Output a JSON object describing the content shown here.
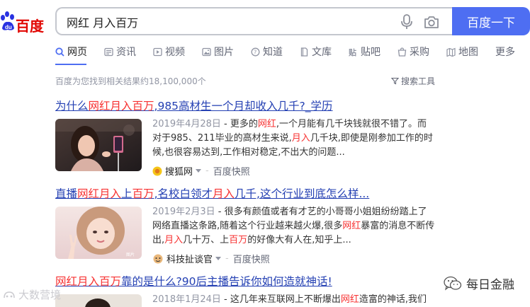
{
  "logo": {
    "text": "百度"
  },
  "search": {
    "query": "网红 月入百万",
    "button_label": "百度一下"
  },
  "tabs": [
    {
      "label": "网页",
      "icon": "search-icon",
      "active": true
    },
    {
      "label": "资讯",
      "icon": "news-icon"
    },
    {
      "label": "视频",
      "icon": "video-icon"
    },
    {
      "label": "图片",
      "icon": "image-icon"
    },
    {
      "label": "知道",
      "icon": "question-icon"
    },
    {
      "label": "文库",
      "icon": "document-icon"
    },
    {
      "label": "贴吧",
      "icon": "tieba-icon"
    },
    {
      "label": "采购",
      "icon": "shop-icon"
    },
    {
      "label": "地图",
      "icon": "map-icon"
    },
    {
      "label": "更多"
    }
  ],
  "meta": {
    "result_count": "百度为您找到相关结果约18,100,000个",
    "tools_label": "搜索工具"
  },
  "results": [
    {
      "title": [
        {
          "t": "为什么"
        },
        {
          "t": "网红月入百万",
          "hl": true
        },
        {
          "t": ",985高材生一个月却收入几千?_学历"
        }
      ],
      "date": "2019年4月28日",
      "abstract": [
        {
          "t": " - 更多的"
        },
        {
          "t": "网红",
          "hl": true
        },
        {
          "t": ",一个月能有几千块钱就很不错了。而对于985、211毕业的高材生来说,"
        },
        {
          "t": "月入",
          "hl": true
        },
        {
          "t": "几千块,即使是刚参加工作的时候,也很容易达到,工作相对稳定,不出大的问题..."
        }
      ],
      "source": "搜狐网",
      "cache": "百度快照"
    },
    {
      "title": [
        {
          "t": "直播"
        },
        {
          "t": "网红月入",
          "hl": true
        },
        {
          "t": "上"
        },
        {
          "t": "百万",
          "hl": true
        },
        {
          "t": ",名校白领才"
        },
        {
          "t": "月入",
          "hl": true
        },
        {
          "t": "几千,这个行业到底怎么样..."
        }
      ],
      "date": "2019年2月3日",
      "abstract": [
        {
          "t": " - 很多有颜值或者有才艺的小哥哥小姐姐纷纷踏上了网络直播这条路,随着这个行业越来越火爆,很多"
        },
        {
          "t": "网红",
          "hl": true
        },
        {
          "t": "暴富的消息不断传出,"
        },
        {
          "t": "月入",
          "hl": true
        },
        {
          "t": "几十万、上"
        },
        {
          "t": "百万",
          "hl": true
        },
        {
          "t": "的好像大有人在,知乎上..."
        }
      ],
      "source": "科技扯谈官",
      "cache": "百度快照"
    },
    {
      "title": [
        {
          "t": "网红月入百万",
          "hl": true
        },
        {
          "t": "靠的是什么?90后主播告诉你如何造就神话!"
        }
      ],
      "date": "2018年1月24日",
      "abstract": [
        {
          "t": " - 这几年来互联网上不断爆出"
        },
        {
          "t": "网红",
          "hl": true
        },
        {
          "t": "造富的神话,我们常"
        }
      ],
      "source": "",
      "cache": ""
    }
  ],
  "watermark": "大数营境",
  "brand": "每日金融"
}
